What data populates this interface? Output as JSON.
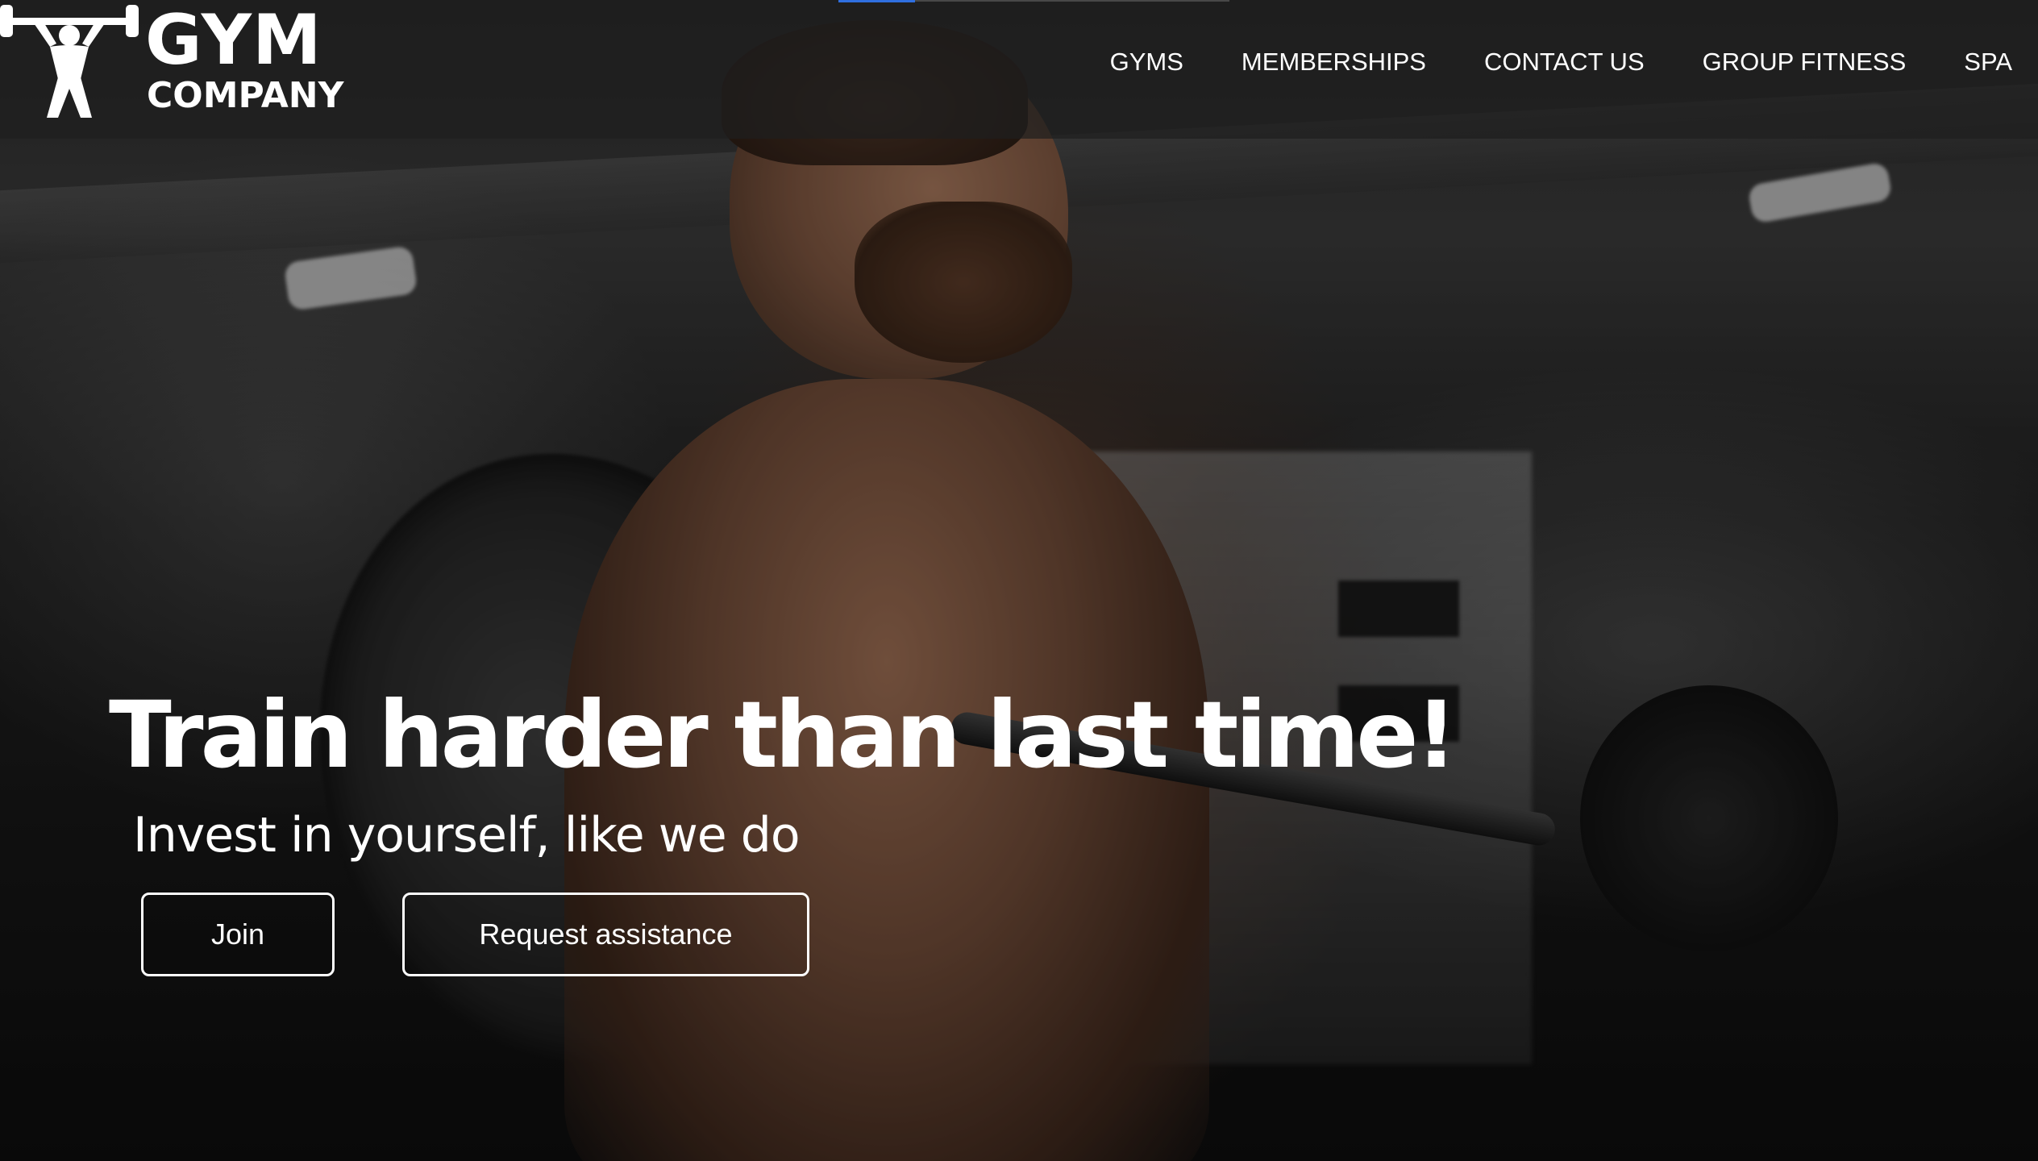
{
  "brand": {
    "logo_line_1": "GYM",
    "logo_line_2": "COMPANY",
    "logo_icon": "weightlifter-icon"
  },
  "nav": {
    "items": [
      {
        "label": "GYMS"
      },
      {
        "label": "MEMBERSHIPS"
      },
      {
        "label": "CONTACT US"
      },
      {
        "label": "GROUP FITNESS"
      },
      {
        "label": "SPA"
      }
    ]
  },
  "hero": {
    "title": "Train harder than last time!",
    "subtitle": "Invest in yourself, like we do",
    "join_label": "Join",
    "assist_label": "Request assistance"
  },
  "colors": {
    "text": "#ffffff",
    "header_bg": "#1e1e1e",
    "accent": "#2f6fe0"
  }
}
